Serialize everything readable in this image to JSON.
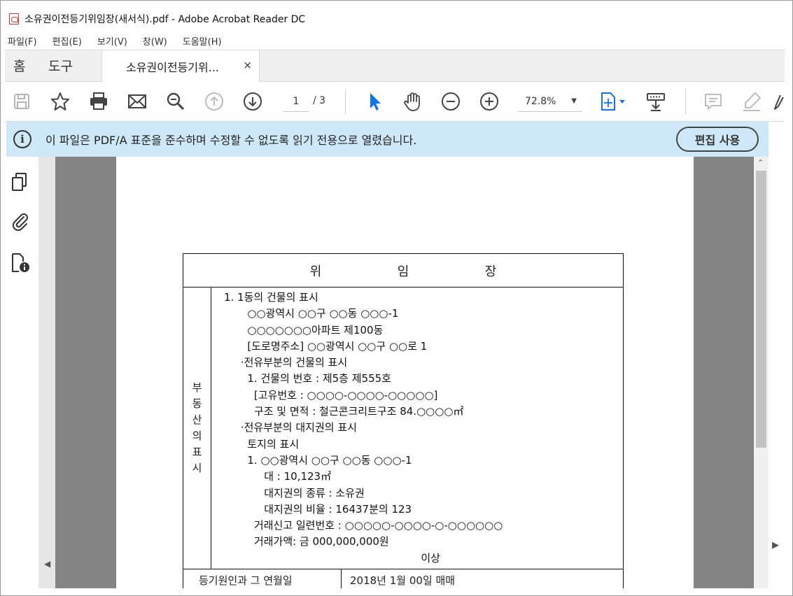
{
  "window": {
    "title": "소유권이전등기위임장(새서식).pdf - Adobe Acrobat Reader DC"
  },
  "menu": [
    "파일(F)",
    "편집(E)",
    "보기(V)",
    "창(W)",
    "도움말(H)"
  ],
  "tabs": {
    "home": "홈",
    "tools": "도구",
    "document": "소유권이전등기위...",
    "close": "×"
  },
  "toolbar": {
    "page_current": "1",
    "page_total": "/ 3",
    "zoom": "72.8%",
    "zoom_caret": "▼",
    "accent_color": "#1473e6"
  },
  "banner": {
    "icon": "i",
    "message": "이 파일은 PDF/A 표준을 준수하며 수정할 수 없도록 읽기 전용으로 열렸습니다.",
    "button": "편집 사용",
    "background": "#cfe8f8"
  },
  "scroll": {
    "up": "⌃",
    "left": "◀",
    "right": "▶"
  },
  "document": {
    "title_chars": [
      "위",
      "임",
      "장"
    ],
    "side_label": [
      "부",
      "동",
      "산",
      "의",
      "표",
      "시"
    ],
    "lines": [
      "1. 1동의 건물의 표시",
      "       ○○광역시 ○○구 ○○동 ○○○-1",
      "       ○○○○○○○아파트 제100동",
      "       [도로명주소] ○○광역시 ○○구 ○○로 1",
      "     ·전유부분의 건물의 표시",
      "       1. 건물의 번호 : 제5층 제555호",
      "         [고유번호 : ○○○○-○○○○-○○○○○]",
      "         구조 및 면적 : 철근콘크리트구조 84.○○○○㎡",
      "     ·전유부분의 대지권의 표시",
      "       토지의 표시",
      "       1. ○○광역시 ○○구 ○○동 ○○○-1",
      "            대 : 10,123㎡",
      "            대지권의 종류 : 소유권",
      "            대지권의 비율 : 16437분의 123",
      "         거래신고 일련번호 : ○○○○○-○○○○-○-○○○○○○",
      "         거래가액: 금 000,000,000원",
      "                                                           이상"
    ],
    "bottom_label": "등기원인과 그 연월일",
    "bottom_value": "2018년 1월 00일 매매"
  }
}
